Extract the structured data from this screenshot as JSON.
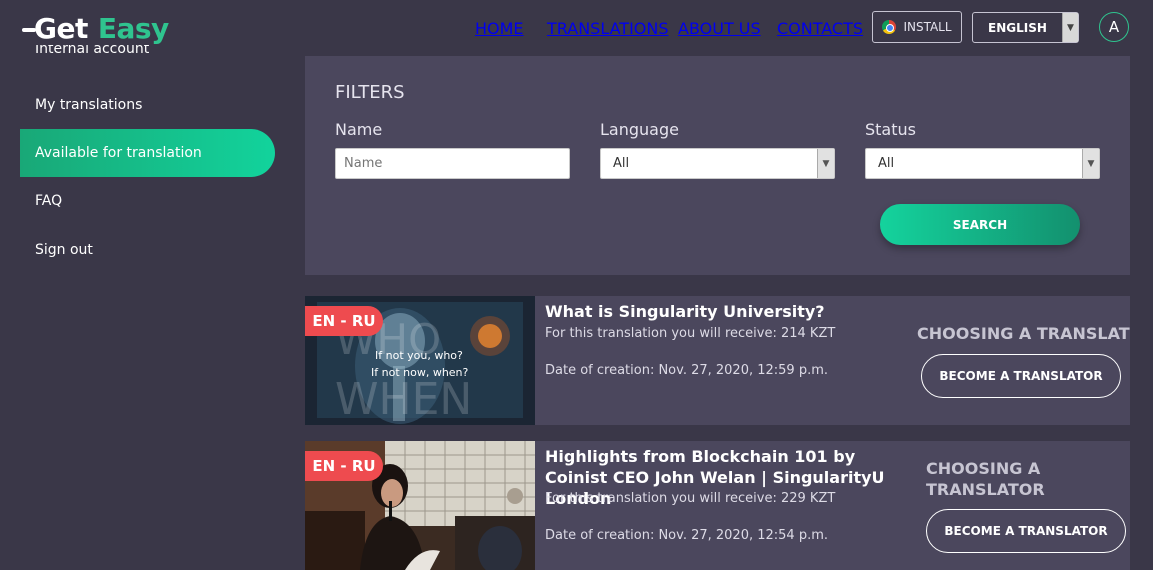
{
  "header": {
    "logo_get": "Get",
    "logo_easy": "Easy",
    "nav": [
      "HOME",
      "TRANSLATIONS",
      "ABOUT US",
      "CONTACTS"
    ],
    "install_label": "INSTALL",
    "language": "ENGLISH",
    "avatar_letter": "A"
  },
  "sidebar": {
    "items": [
      {
        "label": "Internal account"
      },
      {
        "label": "My translations"
      },
      {
        "label": "Available for translation"
      },
      {
        "label": "FAQ"
      },
      {
        "label": "Sign out"
      }
    ]
  },
  "filters": {
    "title": "FILTERS",
    "name_label": "Name",
    "name_placeholder": "Name",
    "language_label": "Language",
    "language_value": "All",
    "status_label": "Status",
    "status_value": "All",
    "search_label": "SEARCH"
  },
  "cards": [
    {
      "lang": "EN - RU",
      "title": "What is Singularity University?",
      "reward": "For this translation you will receive: 214 KZT",
      "date": "Date of creation: Nov. 27, 2020, 12:59 p.m.",
      "status": "CHOOSING A TRANSLATOR",
      "button": "BECOME A TRANSLATOR",
      "thumb_text_1": "If not you, who?",
      "thumb_text_2": "If not now, when?",
      "thumb_bg_word_1": "WHO",
      "thumb_bg_word_2": "WHEN"
    },
    {
      "lang": "EN - RU",
      "title": "Highlights from Blockchain 101 by Coinist CEO John Welan | SingularityU London",
      "reward": "For this translation you will receive: 229 KZT",
      "date": "Date of creation: Nov. 27, 2020, 12:54 p.m.",
      "status": "CHOOSING A TRANSLATOR",
      "button": "BECOME A TRANSLATOR"
    }
  ],
  "colors": {
    "background": "#3a3748",
    "panel": "#4b475d",
    "accent": "#14d39d",
    "badge": "#ee4b4f"
  }
}
